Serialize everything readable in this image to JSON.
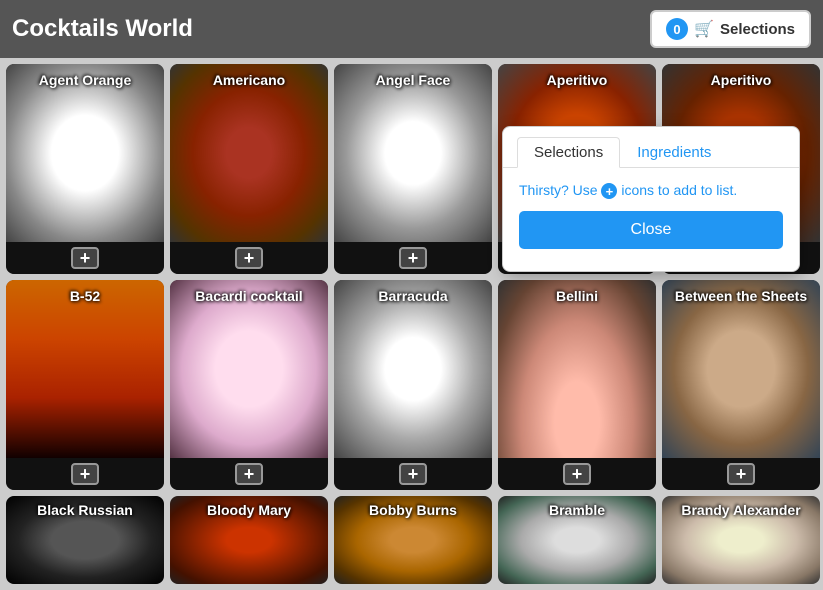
{
  "header": {
    "title": "Cocktails World",
    "selections_button": "Selections",
    "badge_count": "0"
  },
  "popup": {
    "tab_selections": "Selections",
    "tab_ingredients": "Ingredients",
    "hint": "Thirsty? Use",
    "hint_suffix": "icons to add to list.",
    "close_button": "Close"
  },
  "row1": [
    {
      "name": "Agent Orange",
      "img_class": "img-agent-orange"
    },
    {
      "name": "Americano",
      "img_class": "img-americano"
    },
    {
      "name": "Angel Face",
      "img_class": "img-angel-face"
    },
    {
      "name": "Aperitivo",
      "img_class": "img-aperitivo1"
    },
    {
      "name": "Aperitivo",
      "img_class": "img-aperitivo2"
    }
  ],
  "row2": [
    {
      "name": "B-52",
      "img_class": "img-b52"
    },
    {
      "name": "Bacardi cocktail",
      "img_class": "img-bacardi"
    },
    {
      "name": "Barracuda",
      "img_class": "img-barracuda"
    },
    {
      "name": "Bellini",
      "img_class": "img-bellini"
    },
    {
      "name": "Between the Sheets",
      "img_class": "img-between"
    }
  ],
  "row3": [
    {
      "name": "Black Russian",
      "img_class": "img-black-russian"
    },
    {
      "name": "Bloody Mary",
      "img_class": "img-bloody-mary"
    },
    {
      "name": "Bobby Burns",
      "img_class": "img-bobby-burns"
    },
    {
      "name": "Bramble",
      "img_class": "img-bramble"
    },
    {
      "name": "Brandy Alexander",
      "img_class": "img-brandy"
    }
  ],
  "add_button_symbol": "+"
}
